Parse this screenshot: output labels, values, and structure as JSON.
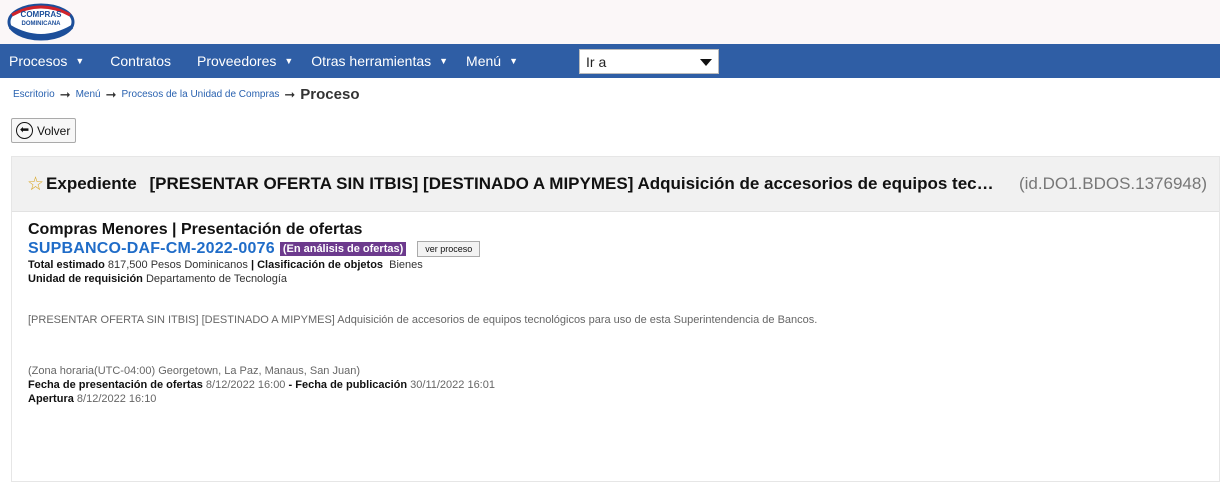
{
  "logo": {
    "lines": [
      "COMPRAS",
      "DOMINICANA"
    ]
  },
  "nav": {
    "items": [
      {
        "label": "Procesos",
        "caret": true
      },
      {
        "label": "Contratos",
        "caret": false
      },
      {
        "label": "Proveedores",
        "caret": true
      },
      {
        "label": "Otras herramientas",
        "caret": true
      },
      {
        "label": "Menú",
        "caret": true
      }
    ],
    "select_value": "Ir a"
  },
  "breadcrumb": {
    "items": [
      "Escritorio",
      "Menú",
      "Procesos de la Unidad de Compras"
    ],
    "current": "Proceso"
  },
  "back_button": {
    "label": "Volver"
  },
  "expediente": {
    "label": "Expediente",
    "title": "[PRESENTAR OFERTA SIN ITBIS] [DESTINADO A MIPYMES] Adquisición de accesorios de equipos tecnológicos para uso de esta Superintendencia de Bancos.",
    "id": "(id.DO1.BDOS.1376948)"
  },
  "process": {
    "type": "Compras Menores | Presentación de ofertas",
    "code": "SUPBANCO-DAF-CM-2022-0076",
    "status": "(En análisis de ofertas)",
    "view_button": "ver proceso",
    "total_label": "Total estimado",
    "total_value": "817,500 Pesos Dominicanos",
    "class_label": "Clasificación de objetos",
    "class_value": "Bienes",
    "unit_label": "Unidad de requisición",
    "unit_value": "Departamento de Tecnología",
    "description": "[PRESENTAR OFERTA SIN ITBIS] [DESTINADO A MIPYMES] Adquisición de accesorios de equipos tecnológicos para uso de esta Superintendencia de Bancos.",
    "timezone": "(Zona horaria(UTC-04:00) Georgetown, La Paz, Manaus, San Juan)",
    "offers_label": "Fecha de presentación de ofertas",
    "offers_value": "8/12/2022 16:00",
    "pub_label": "Fecha de publicación",
    "pub_value": "30/11/2022 16:01",
    "opening_label": "Apertura",
    "opening_value": "8/12/2022 16:10"
  },
  "colors": {
    "navbar": "#2f5ea5",
    "status_badge": "#6c3a8d",
    "code_link": "#1f6cc8"
  }
}
